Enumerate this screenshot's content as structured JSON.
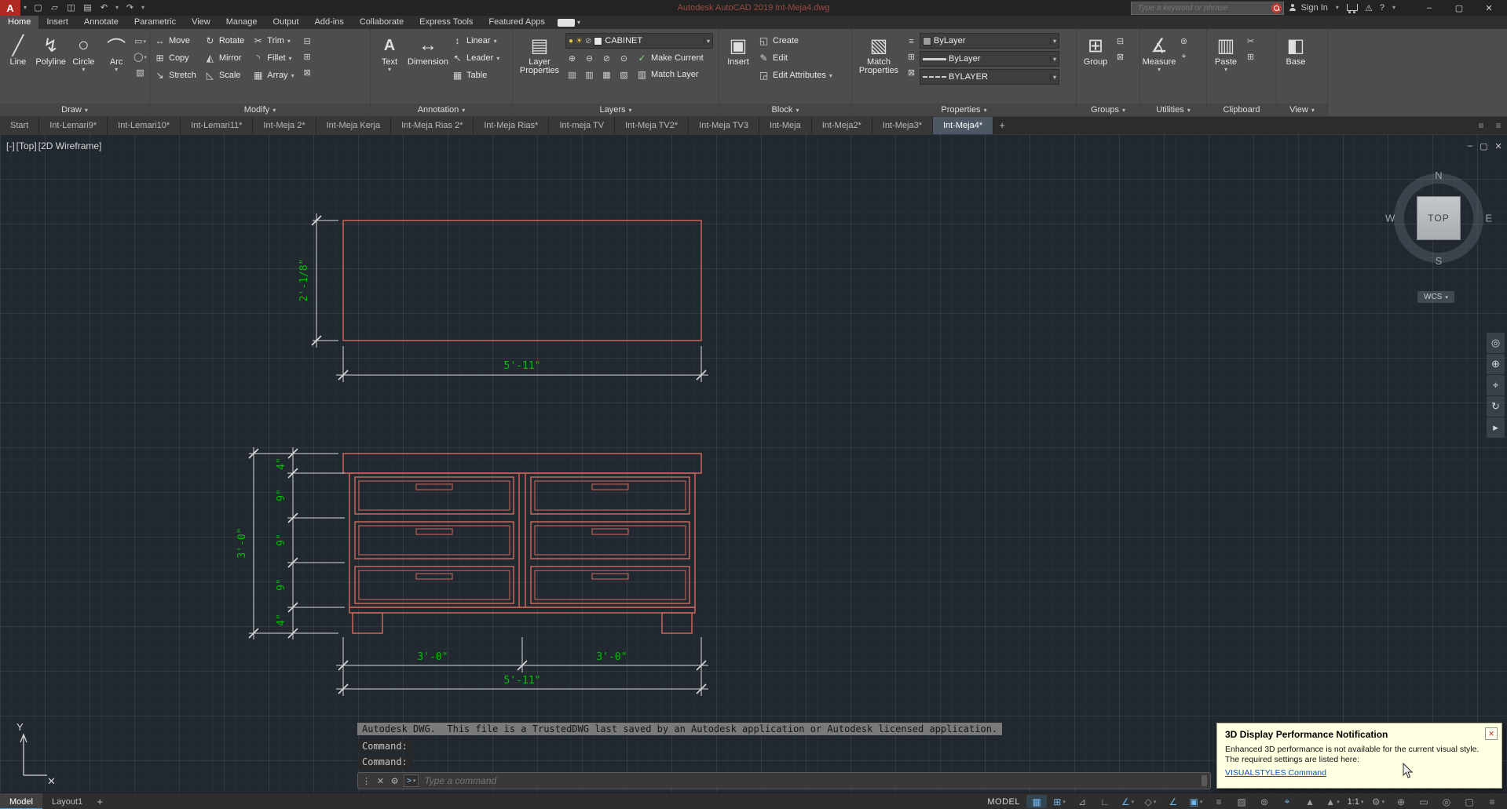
{
  "title_bar": {
    "logo": "A",
    "title": "Autodesk AutoCAD 2019   Int-Meja4.dwg",
    "search_placeholder": "Type a keyword or phrase",
    "sign_in": "Sign In",
    "help": "?"
  },
  "ribbon": {
    "tabs": [
      "Home",
      "Insert",
      "Annotate",
      "Parametric",
      "View",
      "Manage",
      "Output",
      "Add-ins",
      "Collaborate",
      "Express Tools",
      "Featured Apps"
    ],
    "draw": {
      "label": "Draw",
      "line": "Line",
      "polyline": "Polyline",
      "circle": "Circle",
      "arc": "Arc"
    },
    "modify": {
      "label": "Modify",
      "buttons": [
        "Move",
        "Rotate",
        "Trim",
        "Copy",
        "Mirror",
        "Fillet",
        "Stretch",
        "Scale",
        "Array"
      ]
    },
    "annotation": {
      "label": "Annotation",
      "text": "Text",
      "dimension": "Dimension",
      "linear": "Linear",
      "leader": "Leader",
      "table": "Table"
    },
    "layers": {
      "label": "Layers",
      "layer_properties": "Layer Properties",
      "current_layer": "CABINET",
      "make_current": "Make Current",
      "match_layer": "Match Layer"
    },
    "block": {
      "label": "Block",
      "insert": "Insert",
      "create": "Create",
      "edit": "Edit",
      "edit_attributes": "Edit Attributes"
    },
    "properties": {
      "label": "Properties",
      "match_properties": "Match Properties",
      "color": "ByLayer",
      "lineweight": "ByLayer",
      "linetype": "BYLAYER"
    },
    "groups": {
      "label": "Groups",
      "group": "Group"
    },
    "utilities": {
      "label": "Utilities",
      "measure": "Measure"
    },
    "clipboard": {
      "label": "Clipboard",
      "paste": "Paste"
    },
    "view": {
      "label": "View",
      "base": "Base"
    }
  },
  "file_tabs": {
    "items": [
      "Start",
      "Int-Lemari9*",
      "Int-Lemari10*",
      "Int-Lemari11*",
      "Int-Meja 2*",
      "Int-Meja Kerja",
      "Int-Meja Rias 2*",
      "Int-Meja Rias*",
      "Int-meja TV",
      "Int-Meja TV2*",
      "Int-Meja TV3",
      "Int-Meja",
      "Int-Meja2*",
      "Int-Meja3*",
      "Int-Meja4*"
    ],
    "add": "+"
  },
  "viewport": {
    "controls": "[-]",
    "view": "[Top]",
    "style": "[2D Wireframe]",
    "viewcube": {
      "n": "N",
      "w": "W",
      "e": "E",
      "s": "S",
      "top": "TOP",
      "wcs": "WCS"
    }
  },
  "drawing": {
    "dims": {
      "plan_height": "2'-1/8\"",
      "plan_width": "5'-11\"",
      "front_height": "3'-0\"",
      "chain": [
        "4\"",
        "9\"",
        "9\"",
        "9\"",
        "4\""
      ],
      "front_left": "3'-0\"",
      "front_right": "3'-0\"",
      "front_total": "5'-11\""
    },
    "colors": {
      "geometry": "#d4695e",
      "dim_text": "#00c000",
      "dim_line": "#d9d9d9"
    }
  },
  "ucs": {
    "y": "Y",
    "x_marker": "✕"
  },
  "command": {
    "trusted": "Autodesk DWG.  This file is a TrustedDWG last saved by an Autodesk application or Autodesk licensed application.",
    "line1": "Command:",
    "line2": "Command:",
    "placeholder": "Type a command"
  },
  "layout_tabs": {
    "model": "Model",
    "layout1": "Layout1",
    "add": "+"
  },
  "status": {
    "model": "MODEL",
    "scale": "1:1"
  },
  "notification": {
    "title": "3D Display Performance Notification",
    "line1": "Enhanced 3D performance is not available for the current visual style.",
    "line2": "The required settings are listed here:",
    "link": "VISUALSTYLES Command"
  },
  "icons": {
    "caret": "▾",
    "min": "–",
    "max": "▢",
    "close": "✕",
    "new": "▢",
    "open": "▱",
    "save": "◫",
    "plot": "▤",
    "undo": "↶",
    "redo": "↷",
    "warn": "⚠",
    "line": "╱",
    "polyline": "↯",
    "circle": "○",
    "arc": "⌒",
    "rect": "▭",
    "ellipse": "◯",
    "hatch": "▨",
    "move": "↔",
    "rotate": "↻",
    "trim": "✂",
    "copy": "⊞",
    "mirror": "◭",
    "fillet": "◝",
    "stretch": "↘",
    "scale": "◺",
    "array": "▦",
    "text": "A",
    "dimension": "↔",
    "linear": "↕",
    "leader": "↖",
    "table": "▦",
    "layer_props": "▤",
    "bulb": "●",
    "sun": "☀",
    "lock": "⊘",
    "make_current": "✓",
    "match_layer": "▥",
    "layer_tools": [
      "⊕",
      "⊖",
      "⊘",
      "⊙",
      "▤",
      "▥",
      "▦",
      "▧"
    ],
    "insert": "▣",
    "create": "◱",
    "edit": "✎",
    "edit_attrs": "◲",
    "match_props": "▧",
    "prop_tools": [
      "⊟",
      "⊞",
      "⊠"
    ],
    "group": "⊞",
    "group_tools": [
      "⊟",
      "⊠"
    ],
    "measure": "∡",
    "util_tools": [
      "⊚",
      "⌖"
    ],
    "paste": "▥",
    "clip_tools": [
      "✂",
      "⊞"
    ],
    "base": "◧",
    "grid": "▦",
    "snap": "⊞",
    "infer": "⊿",
    "ortho": "∟",
    "polar": "∠",
    "iso": "◇",
    "otrack": "∠",
    "osnap": "▣",
    "lwt": "≡",
    "transp": "▨",
    "selcycle": "⊚",
    "dyn": "⌖",
    "annvis": "▲",
    "autoscale": "▲",
    "gear": "⚙",
    "target": "⊕",
    "perf": "▭",
    "isolate": "◎",
    "clean": "▢",
    "menu": "≡",
    "grip": "⋮",
    "wrench": "⚙",
    "prompt": "&gt;",
    "nav": [
      "◎",
      "⊕",
      "⌖",
      "↻",
      "▸"
    ],
    "tab_menu": "≡"
  }
}
